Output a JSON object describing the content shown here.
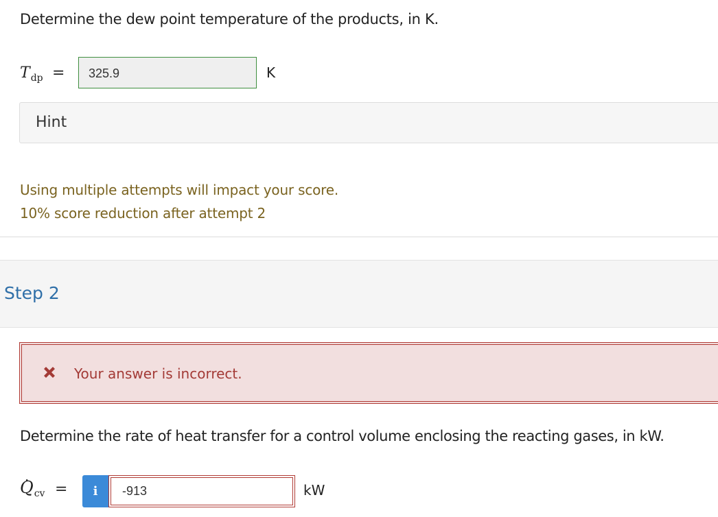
{
  "step1": {
    "question": "Determine the dew point temperature of the products, in K.",
    "var_symbol": "T",
    "var_subscript": "dp",
    "equals": "=",
    "answer_value": "325.9",
    "unit": "K",
    "hint_label": "Hint",
    "attempts_line1": "Using multiple attempts will impact your score.",
    "attempts_line2": "10% score reduction after attempt 2"
  },
  "step2": {
    "title": "Step 2",
    "feedback": "Your answer is incorrect.",
    "question": "Determine the rate of heat transfer for a control volume enclosing the reacting gases, in kW.",
    "var_symbol": "Q",
    "var_dot": "·",
    "var_subscript": "cv",
    "equals": "=",
    "info_label": "i",
    "answer_value": "-913",
    "unit": "kW"
  },
  "colors": {
    "correct_border": "#3e8e3e",
    "incorrect": "#b03a34",
    "incorrect_bg": "#f2dfdf",
    "step_title": "#2f6fa8",
    "attempts_text": "#7a6320",
    "info_button": "#3b8ad8"
  },
  "icons": {
    "feedback_icon": "x-mark-icon",
    "info_icon": "info-icon"
  }
}
